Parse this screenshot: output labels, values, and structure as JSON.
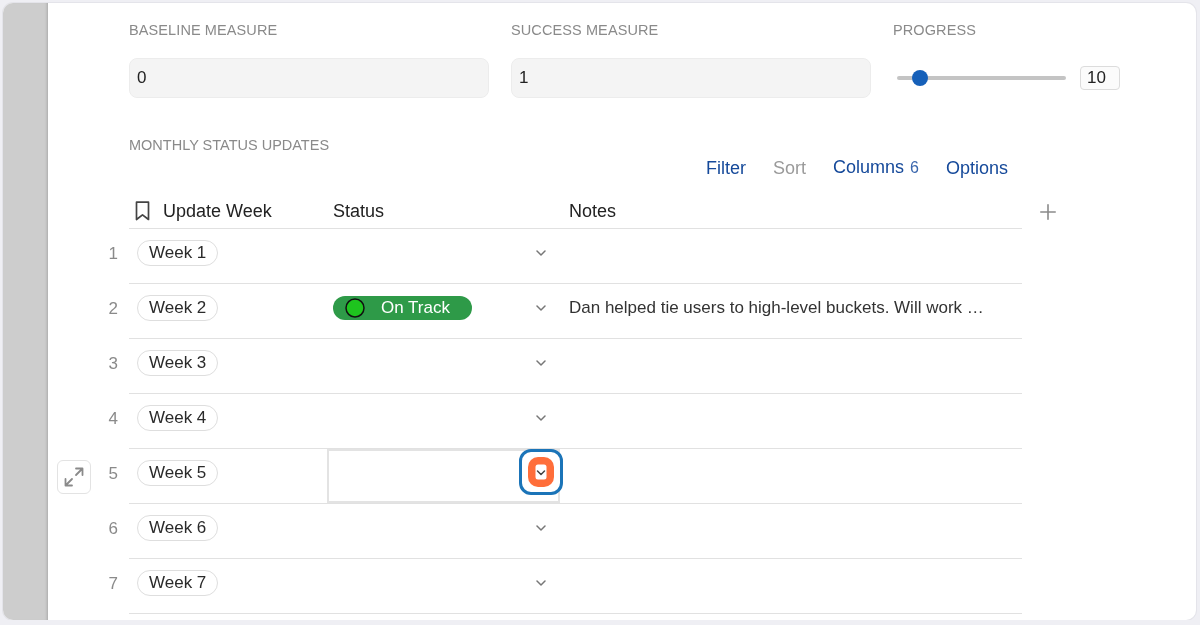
{
  "fields": [
    {
      "label": "BASELINE MEASURE",
      "value": "0"
    },
    {
      "label": "SUCCESS MEASURE",
      "value": "1"
    }
  ],
  "progress": {
    "label": "PROGRESS",
    "level": 0.1,
    "reading": "10"
  },
  "section_title": "MONTHLY STATUS UPDATES",
  "toolbar": [
    {
      "label": "Filter",
      "disabled": false
    },
    {
      "label": "Sort",
      "disabled": true
    },
    {
      "label": "Columns",
      "count": "6",
      "disabled": false
    },
    {
      "label": "Options",
      "disabled": false
    }
  ],
  "table": {
    "columns": [
      "Update Week",
      "Status",
      "Notes"
    ],
    "rows": [
      {
        "number": "1",
        "week": "Week 1",
        "selected": false
      },
      {
        "number": "2",
        "week": "Week 2",
        "status": {
          "label": "On Track",
          "kind": "on_track"
        },
        "notes": "Dan helped tie users to high-level buckets. Will work …",
        "selected": false
      },
      {
        "number": "3",
        "week": "Week 3",
        "selected": false
      },
      {
        "number": "4",
        "week": "Week 4",
        "selected": false
      },
      {
        "number": "5",
        "week": "Week 5",
        "selected": true
      },
      {
        "number": "6",
        "week": "Week 6",
        "selected": false
      },
      {
        "number": "7",
        "week": "Week 7",
        "selected": false
      }
    ]
  }
}
